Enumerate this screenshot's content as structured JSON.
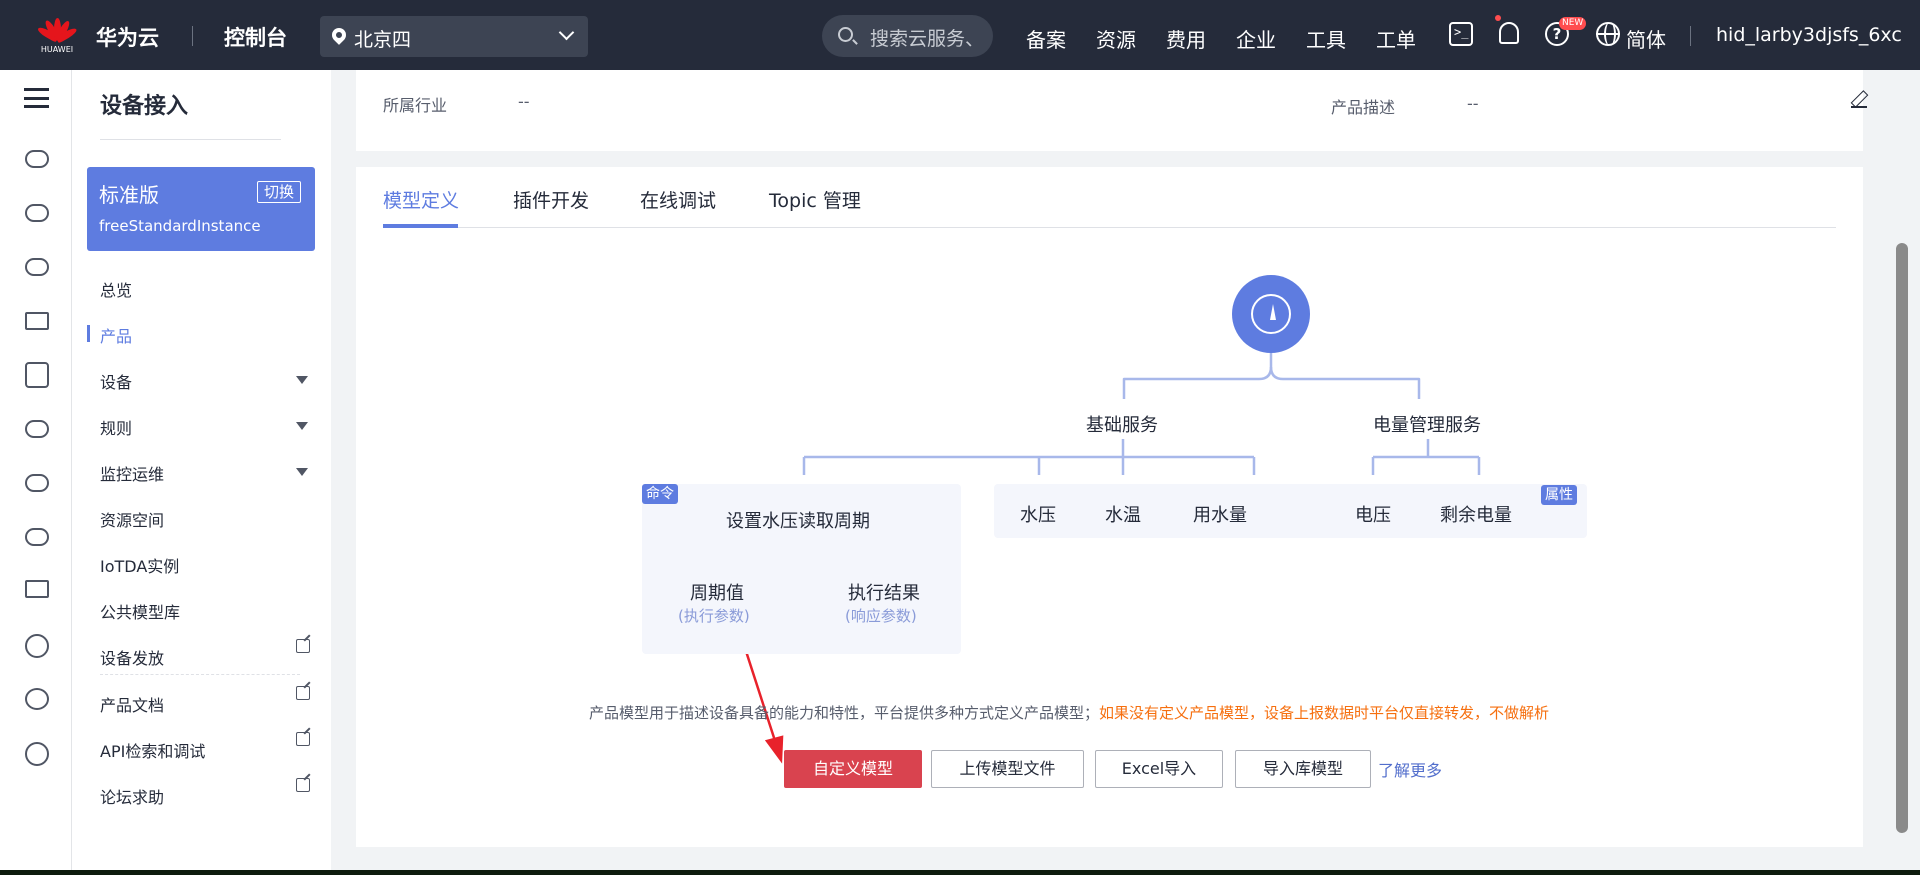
{
  "topbar": {
    "logo_text": "HUAWEI",
    "brand": "华为云",
    "console": "控制台",
    "region": "北京四",
    "search_placeholder": "搜索云服务、",
    "nav": [
      "备案",
      "资源",
      "费用",
      "企业",
      "工具",
      "工单"
    ],
    "new_badge": "NEW",
    "language": "简体",
    "user": "hid_larby3djsfs_6xc"
  },
  "sidebar": {
    "title": "设备接入",
    "edition": {
      "name": "标准版",
      "switch": "切换",
      "instance": "freeStandardInstance"
    },
    "items": [
      {
        "label": "总览"
      },
      {
        "label": "产品",
        "active": true
      },
      {
        "label": "设备",
        "expandable": true
      },
      {
        "label": "规则",
        "expandable": true
      },
      {
        "label": "监控运维",
        "expandable": true
      },
      {
        "label": "资源空间"
      },
      {
        "label": "IoTDA实例"
      },
      {
        "label": "公共模型库"
      },
      {
        "label": "设备发放",
        "external": true
      },
      {
        "label": "产品文档",
        "external": true
      },
      {
        "label": "API检索和调试",
        "external": true
      },
      {
        "label": "论坛求助",
        "external": true
      }
    ]
  },
  "product_info": {
    "industry_label": "所属行业",
    "industry_value": "--",
    "description_label": "产品描述",
    "description_value": "--"
  },
  "tabs": [
    "模型定义",
    "插件开发",
    "在线调试",
    "Topic 管理"
  ],
  "model_diagram": {
    "services": [
      "基础服务",
      "电量管理服务"
    ],
    "command_tag": "命令",
    "command": "设置水压读取周期",
    "command_params": [
      {
        "name": "周期值",
        "type": "(执行参数)"
      },
      {
        "name": "执行结果",
        "type": "(响应参数)"
      }
    ],
    "basic_properties": [
      "水压",
      "水温",
      "用水量"
    ],
    "power_properties": [
      "电压",
      "剩余电量"
    ],
    "property_tag": "属性"
  },
  "description": {
    "text": "产品模型用于描述设备具备的能力和特性，平台提供多种方式定义产品模型；",
    "warning": "如果没有定义产品模型，设备上报数据时平台仅直接转发，不做解析"
  },
  "actions": {
    "custom_model": "自定义模型",
    "upload_model": "上传模型文件",
    "excel_import": "Excel导入",
    "import_library": "导入库模型",
    "learn_more": "了解更多"
  },
  "colors": {
    "topbar": "#252b3a",
    "accent": "#5e7ce0",
    "primary_button": "#d9434f",
    "warning_text": "#f66f0f",
    "annotation_arrow": "#e8222b"
  }
}
